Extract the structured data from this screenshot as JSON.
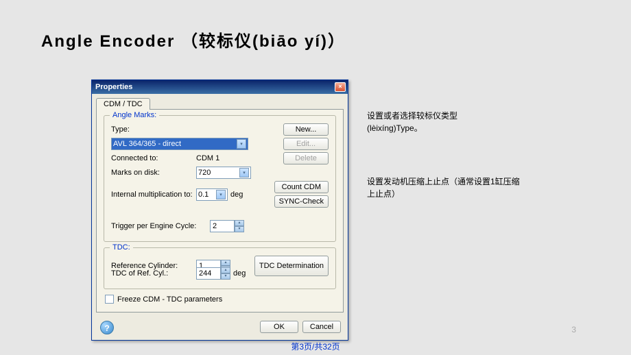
{
  "slide": {
    "title": "Angle Encoder （较标仪(biāo yí)）",
    "page_num": "3",
    "footer": "第3页/共32页"
  },
  "dialog": {
    "title": "Properties",
    "close": "×",
    "tab": "CDM / TDC",
    "angle_marks": {
      "legend": "Angle Marks:",
      "type_label": "Type:",
      "type_value": "AVL 364/365 - direct",
      "connected_label": "Connected to:",
      "connected_value": "CDM 1",
      "marks_label": "Marks on disk:",
      "marks_value": "720",
      "internal_label": "Internal multiplication to:",
      "internal_value": "0.1",
      "internal_unit": "deg",
      "trigger_label": "Trigger per Engine Cycle:",
      "trigger_value": "2",
      "btn_new": "New...",
      "btn_edit": "Edit...",
      "btn_delete": "Delete",
      "btn_count": "Count CDM",
      "btn_sync": "SYNC-Check"
    },
    "tdc": {
      "legend": "TDC:",
      "ref_cyl_label": "Reference Cylinder:",
      "ref_cyl_value": "1",
      "tdc_ref_label": "TDC of Ref. Cyl.:",
      "tdc_ref_value": "244",
      "tdc_ref_unit": "deg",
      "btn_determination": "TDC Determination"
    },
    "freeze_label": "Freeze CDM - TDC parameters",
    "help": "?",
    "btn_ok": "OK",
    "btn_cancel": "Cancel"
  },
  "annotations": {
    "a1": "设置或者选择较标仪类型(lèixíng)Type。",
    "a2": "设置发动机压缩上止点（通常设置1缸压缩上止点）"
  }
}
